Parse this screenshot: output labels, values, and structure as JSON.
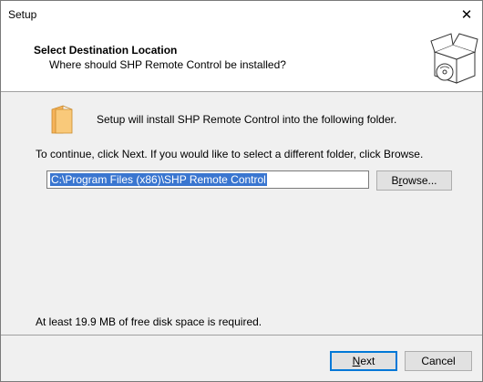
{
  "window": {
    "title": "Setup"
  },
  "header": {
    "title": "Select Destination Location",
    "subtitle": "Where should SHP Remote Control be installed?"
  },
  "content": {
    "install_message": "Setup will install SHP Remote Control into the following folder.",
    "continue_message": "To continue, click Next. If you would like to select a different folder, click Browse.",
    "path_value": "C:\\Program Files (x86)\\SHP Remote Control",
    "browse_prefix": "B",
    "browse_hotkey": "r",
    "browse_suffix": "owse...",
    "disk_space_message": "At least 19.9 MB of free disk space is required."
  },
  "footer": {
    "next_hotkey": "N",
    "next_rest": "ext",
    "cancel_label": "Cancel"
  },
  "colors": {
    "selection": "#3a76d0",
    "default_button_border": "#0078d7"
  }
}
